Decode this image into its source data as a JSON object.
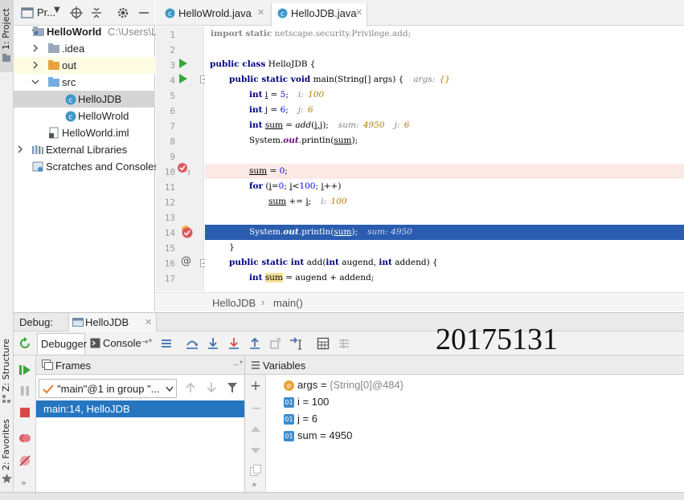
{
  "left_strip": {
    "project_tab": "1: Project",
    "structure_tab": "Z: Structure",
    "favorites_tab": "2: Favorites"
  },
  "project_panel": {
    "title": "Pr...",
    "tree": [
      {
        "label": "HelloWorld",
        "extra": "C:\\Users\\L",
        "kind": "module"
      },
      {
        "label": ".idea",
        "kind": "folder"
      },
      {
        "label": "out",
        "kind": "folder-orange"
      },
      {
        "label": "src",
        "kind": "folder-blue"
      },
      {
        "label": "HelloJDB",
        "kind": "class"
      },
      {
        "label": "HelloWrold",
        "kind": "class"
      },
      {
        "label": "HelloWorld.iml",
        "kind": "file"
      },
      {
        "label": "External Libraries",
        "kind": "libraries"
      },
      {
        "label": "Scratches and Consoles",
        "kind": "scratches"
      }
    ]
  },
  "editor": {
    "tabs": [
      {
        "label": "HelloWrold.java",
        "active": false
      },
      {
        "label": "HelloJDB.java",
        "active": true
      }
    ],
    "lines": [
      {
        "n": "1"
      },
      {
        "n": "2"
      },
      {
        "n": "3"
      },
      {
        "n": "4"
      },
      {
        "n": "5"
      },
      {
        "n": "6"
      },
      {
        "n": "7"
      },
      {
        "n": "8"
      },
      {
        "n": "9"
      },
      {
        "n": "10"
      },
      {
        "n": "11"
      },
      {
        "n": "12"
      },
      {
        "n": "13"
      },
      {
        "n": "14"
      },
      {
        "n": "15"
      },
      {
        "n": "16"
      },
      {
        "n": "17"
      }
    ],
    "code": {
      "l1_kw": "import static",
      "l1_rest": " netscape.security.Privilege.add;",
      "l3_kw": "public class",
      "l3_rest": " HelloJDB {",
      "l4_kw": "public static void",
      "l4_rest": " main(String[] args) {",
      "l4_hint": "args:",
      "l4_val": "{}",
      "l5_kw": "int",
      "l5_var": "i",
      "l5_eq": " = ",
      "l5_num": "5",
      "l5_end": ";",
      "l5_hint": "i:",
      "l5_val": "100",
      "l6_kw": "int",
      "l6_rest": " j = ",
      "l6_num": "6",
      "l6_end": ";",
      "l6_hint": "j:",
      "l6_val": "6",
      "l7_kw": "int",
      "l7_var": "sum",
      "l7_mid": " = ",
      "l7_call": "add",
      "l7_args_open": "(",
      "l7_a1": "i",
      "l7_sep": ",",
      "l7_a2": "j",
      "l7_end": ");",
      "l7_hint1": "sum:",
      "l7_val1": "4950",
      "l7_hint2": "j:",
      "l7_val2": "6",
      "l8_pre": "System.",
      "l8_out": "out",
      "l8_mid": ".println(",
      "l8_arg": "sum",
      "l8_end": ");",
      "l10_var": "sum",
      "l10_eq": " = ",
      "l10_num": "0",
      "l10_end": ";",
      "l11_kw": "for",
      "l11_open": " (",
      "l11_i1": "i",
      "l11_eq": "=",
      "l11_n0": "0",
      "l11_s1": "; ",
      "l11_i2": "i",
      "l11_lt": "<",
      "l11_n100": "100",
      "l11_s2": "; ",
      "l11_i3": "i",
      "l11_inc": "++)",
      "l12_var": "sum",
      "l12_op": " += ",
      "l12_i": "i",
      "l12_end": ";",
      "l12_hint": "i:",
      "l12_val": "100",
      "l14_pre": "System.",
      "l14_out": "out",
      "l14_mid": ".println(",
      "l14_arg": "sum",
      "l14_end": ");",
      "l14_hint": "sum:",
      "l14_val": "4950",
      "l15": "}",
      "l16_kw": "public static int",
      "l16_mid": " add(",
      "l16_kw2": "int",
      "l16_a": " augend, ",
      "l16_kw3": "int",
      "l16_b": " addend) {",
      "l17_kw": "int",
      "l17_var": "sum",
      "l17_rest": " = augend + addend;"
    },
    "breadcrumb": {
      "class_name": "HelloJDB",
      "sep": "›",
      "method": "main()"
    }
  },
  "debug": {
    "label": "Debug:",
    "session_tab": "HelloJDB",
    "debugger_tab": "Debugger",
    "console_tab": "Console",
    "console_suffix": "→*",
    "watermark": "20175131",
    "frames": {
      "title": "Frames",
      "thread_select": "\"main\"@1 in group \"...",
      "items": [
        {
          "label": "main:14, HelloJDB",
          "selected": true
        }
      ]
    },
    "variables": {
      "title": "Variables",
      "items": [
        {
          "badge": "p",
          "name": "args",
          "eq": " = ",
          "value": "{String[0]@484}",
          "muted": true
        },
        {
          "badge": "01",
          "name": "i",
          "eq": " = ",
          "value": "100",
          "muted": false
        },
        {
          "badge": "01",
          "name": "j",
          "eq": " = ",
          "value": "6",
          "muted": false
        },
        {
          "badge": "01",
          "name": "sum",
          "eq": " = ",
          "value": "4950",
          "muted": false
        }
      ]
    }
  },
  "colors": {
    "selection": "#2a5db0",
    "frame_selection": "#2675bf",
    "breakpoint_line": "#fbe9e6",
    "tree_selected": "#d5d5d5",
    "out_row": "#fdfce2"
  }
}
